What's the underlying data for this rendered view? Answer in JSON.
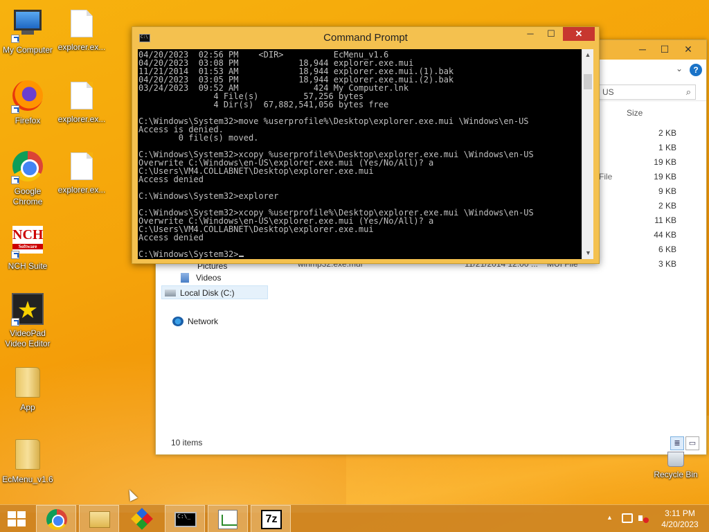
{
  "desktop": {
    "icons": [
      {
        "label": "My Computer",
        "icon": "computer-icon"
      },
      {
        "label": "explorer.ex...",
        "icon": "document-icon"
      },
      {
        "label": "Firefox",
        "icon": "firefox-icon"
      },
      {
        "label": "explorer.ex...",
        "icon": "document-icon"
      },
      {
        "label": "Google Chrome",
        "icon": "chrome-icon"
      },
      {
        "label": "explorer.ex...",
        "icon": "document-icon"
      },
      {
        "label": "NCH Suite",
        "icon": "nch-icon",
        "glyph": "NCH",
        "sub": "Software"
      },
      {
        "label": "VideoPad Video Editor",
        "icon": "videopad-icon",
        "glyph": "★"
      },
      {
        "label": "App",
        "icon": "folder-icon"
      },
      {
        "label": "EcMenu_v1.6",
        "icon": "folder-icon"
      }
    ],
    "recycle_bin": "Recycle Bin"
  },
  "cmd": {
    "title": "Command Prompt",
    "icon_text": "C:\\",
    "minimize": "─",
    "maximize": "☐",
    "close": "✕",
    "output": "04/20/2023  02:56 PM    <DIR>          EcMenu_v1.6\n04/20/2023  03:08 PM            18,944 explorer.exe.mui\n11/21/2014  01:53 AM            18,944 explorer.exe.mui.(1).bak\n04/20/2023  03:05 PM            18,944 explorer.exe.mui.(2).bak\n03/24/2023  09:52 AM               424 My Computer.lnk\n               4 File(s)         57,256 bytes\n               4 Dir(s)  67,882,541,056 bytes free\n\nC:\\Windows\\System32>move %userprofile%\\Desktop\\explorer.exe.mui \\Windows\\en-US\nAccess is denied.\n        0 file(s) moved.\n\nC:\\Windows\\System32>xcopy %userprofile%\\Desktop\\explorer.exe.mui \\Windows\\en-US\nOverwrite C:\\Windows\\en-US\\explorer.exe.mui (Yes/No/All)? a\nC:\\Users\\VM4.COLLABNET\\Desktop\\explorer.exe.mui\nAccess denied\n\nC:\\Windows\\System32>explorer\n\nC:\\Windows\\System32>xcopy %userprofile%\\Desktop\\explorer.exe.mui \\Windows\\en-US\nOverwrite C:\\Windows\\en-US\\explorer.exe.mui (Yes/No/All)? a\nC:\\Users\\VM4.COLLABNET\\Desktop\\explorer.exe.mui\nAccess denied\n\nC:\\Windows\\System32>",
    "scroll_up": "▲",
    "scroll_down": "▼"
  },
  "explorer": {
    "minimize": "─",
    "maximize": "☐",
    "close": "✕",
    "chevron": "⌄",
    "help": "?",
    "search_text": "US",
    "search_icon": "⌕",
    "column_size": "Size",
    "file_type_label": "File",
    "sizes": [
      "2 KB",
      "1 KB",
      "19 KB",
      "19 KB",
      "9 KB",
      "2 KB",
      "11 KB",
      "44 KB",
      "6 KB",
      "3 KB"
    ],
    "partial_row_name": "winmp32.exe.mui",
    "partial_row_date": "11/21/2014 12:00 ...",
    "partial_row_type": "MUI File",
    "nav": {
      "pictures": "Pictures",
      "videos": "Videos",
      "local_disk": "Local Disk (C:)",
      "network": "Network"
    },
    "status": "10 items"
  },
  "taskbar": {
    "clock_time": "3:11 PM",
    "clock_date": "4/20/2023",
    "cmd_icon_text": "C:\\_",
    "sevenzip_text": "7z",
    "tray_chevron": "▲"
  }
}
